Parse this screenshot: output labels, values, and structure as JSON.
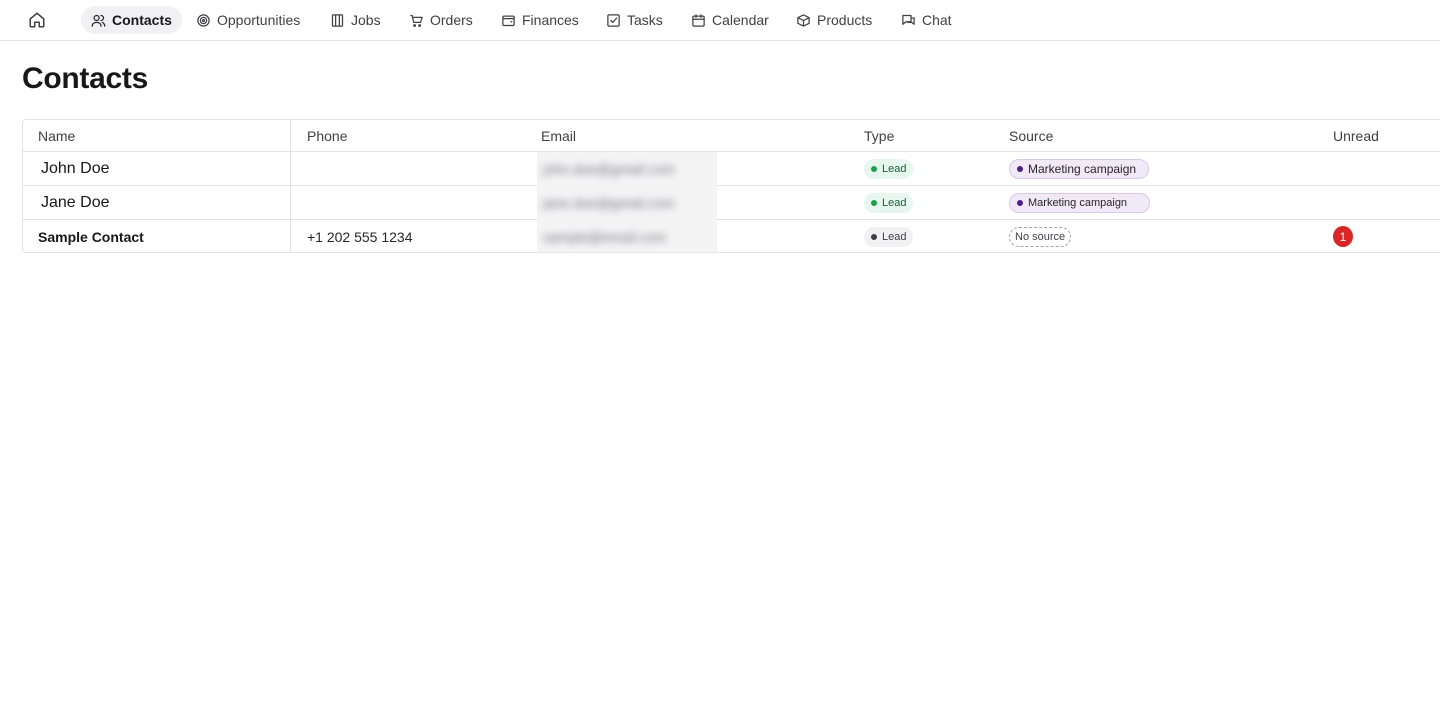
{
  "nav": {
    "home_icon": "home-icon",
    "items": [
      {
        "label": "Contacts",
        "icon": "users-icon",
        "active": true
      },
      {
        "label": "Opportunities",
        "icon": "target-icon"
      },
      {
        "label": "Jobs",
        "icon": "building-icon"
      },
      {
        "label": "Orders",
        "icon": "cart-icon"
      },
      {
        "label": "Finances",
        "icon": "wallet-icon"
      },
      {
        "label": "Tasks",
        "icon": "checkbox-icon"
      },
      {
        "label": "Calendar",
        "icon": "calendar-icon"
      },
      {
        "label": "Products",
        "icon": "package-icon"
      },
      {
        "label": "Chat",
        "icon": "chat-icon"
      }
    ]
  },
  "page": {
    "title": "Contacts"
  },
  "table": {
    "columns": [
      "Name",
      "Phone",
      "Email",
      "Type",
      "Source",
      "Unread"
    ],
    "rows": [
      {
        "name": "John Doe",
        "phone": "",
        "email": "john.doe@gmail.com",
        "type": "Lead",
        "source": "Marketing campaign",
        "unread": ""
      },
      {
        "name": "Jane Doe",
        "phone": "",
        "email": "jane.doe@gmail.com",
        "type": "Lead",
        "source": "Marketing campaign",
        "unread": ""
      },
      {
        "name": "Sample Contact",
        "phone": "+1 202 555 1234",
        "email": "sample@email.com",
        "type": "Lead",
        "source": "No source",
        "unread": "1"
      }
    ]
  },
  "colors": {
    "lead_badge_bg": "#e7f6ee",
    "source_badge_bg": "#f1e8f8",
    "unread_badge": "#dc2626",
    "active_nav_bg": "#f1f1f3"
  }
}
